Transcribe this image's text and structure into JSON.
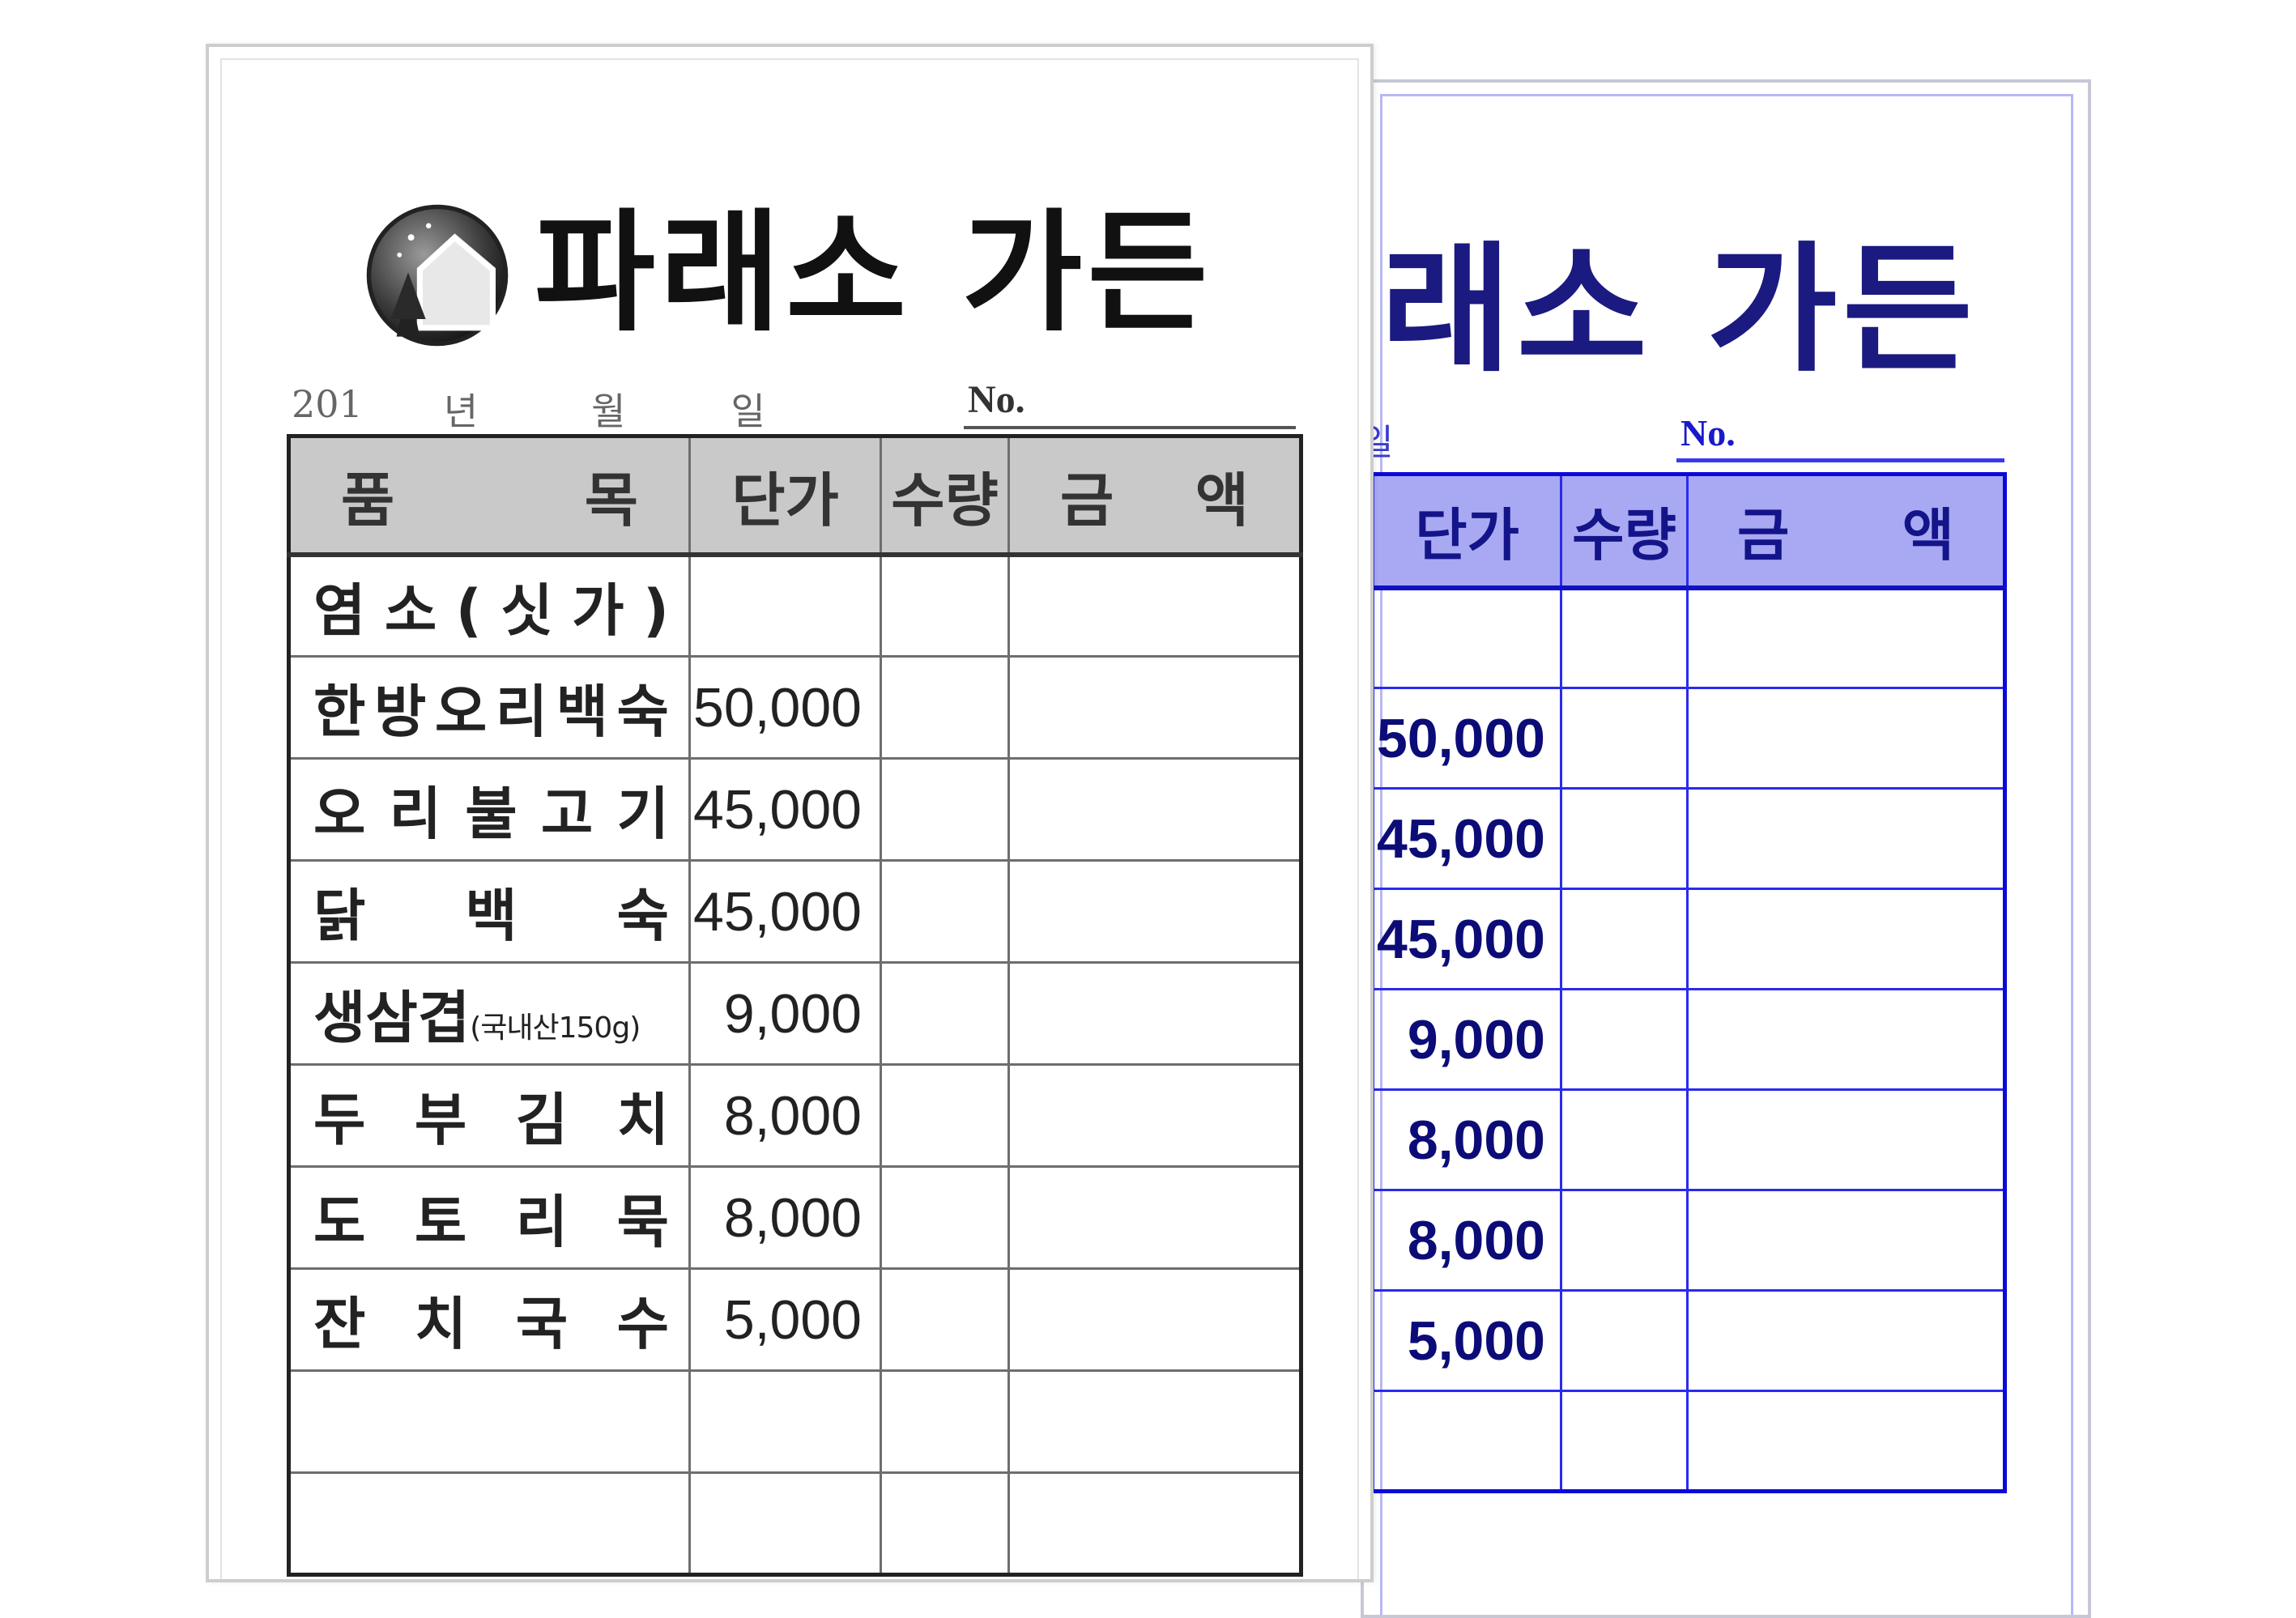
{
  "shop_name": "파래소 가든",
  "back_sheet": {
    "title": "래소 가든",
    "date_fragment": "일",
    "no_label": "No.",
    "headers": [
      "단가",
      "수량",
      "금",
      "액"
    ],
    "prices": [
      "",
      "50,000",
      "45,000",
      "45,000",
      "9,000",
      "8,000",
      "8,000",
      "5,000",
      ""
    ]
  },
  "front_sheet": {
    "date_year": "201",
    "date_year_unit": "년",
    "date_month_unit": "월",
    "date_day_unit": "일",
    "no_label": "No.",
    "headers": {
      "item_left": "품",
      "item_right": "목",
      "unit_price": "단가",
      "quantity": "수량",
      "amount_left": "금",
      "amount_right": "액"
    },
    "rows": [
      {
        "chars": [
          "염",
          "소",
          "(",
          "싯",
          "가",
          ")"
        ],
        "note": "",
        "price": ""
      },
      {
        "chars": [
          "한",
          "방",
          "오",
          "리",
          "백",
          "숙"
        ],
        "note": "",
        "price": "50,000"
      },
      {
        "chars": [
          "오",
          "리",
          "불",
          "고",
          "기"
        ],
        "note": "",
        "price": "45,000"
      },
      {
        "chars": [
          "닭",
          "백",
          "숙"
        ],
        "note": "",
        "price": "45,000"
      },
      {
        "chars": [
          "생",
          "삼",
          "겹"
        ],
        "note": "(국내산150g)",
        "price": "9,000"
      },
      {
        "chars": [
          "두",
          "부",
          "김",
          "치"
        ],
        "note": "",
        "price": "8,000"
      },
      {
        "chars": [
          "도",
          "토",
          "리",
          "묵"
        ],
        "note": "",
        "price": "8,000"
      },
      {
        "chars": [
          "잔",
          "치",
          "국",
          "수"
        ],
        "note": "",
        "price": "5,000"
      },
      {
        "chars": [],
        "note": "",
        "price": ""
      },
      {
        "chars": [],
        "note": "",
        "price": ""
      }
    ]
  },
  "colors": {
    "front_header_bg": "#c9c9c9",
    "back_header_bg": "#a9a9f3",
    "back_text": "#0c0c78",
    "back_border": "#0a0ad8"
  }
}
